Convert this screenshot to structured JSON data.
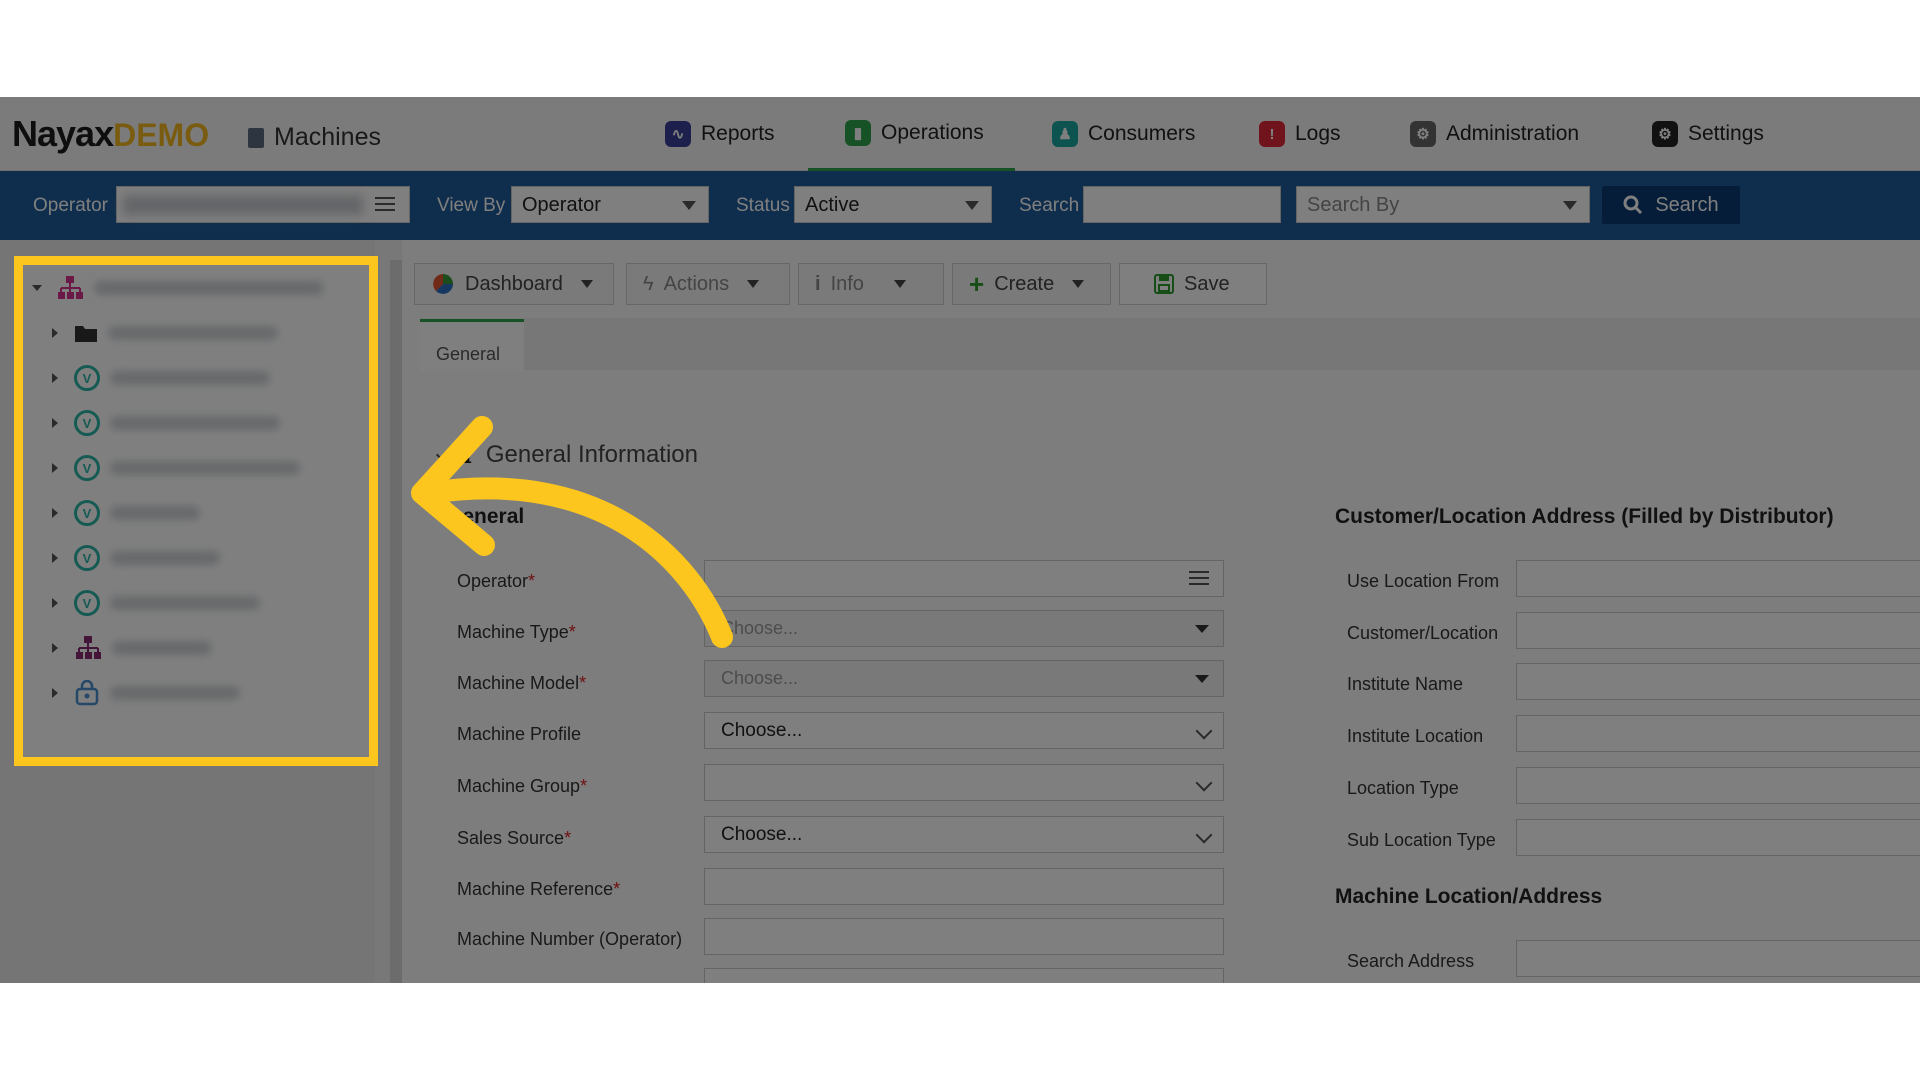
{
  "header": {
    "logo_brand": "Nayax",
    "logo_suffix": "DEMO",
    "module": "Machines",
    "nav": [
      {
        "label": "Reports",
        "color": "#3b3f9a"
      },
      {
        "label": "Operations",
        "color": "#2ea44f",
        "active": true
      },
      {
        "label": "Consumers",
        "color": "#1aa6a0"
      },
      {
        "label": "Logs",
        "color": "#e0263a"
      },
      {
        "label": "Administration",
        "color": "#555555"
      },
      {
        "label": "Settings",
        "color": "#222222"
      }
    ]
  },
  "toolbar": {
    "operator_label": "Operator",
    "viewby_label": "View By",
    "viewby_value": "Operator",
    "status_label": "Status",
    "status_value": "Active",
    "search_label": "Search",
    "searchby_placeholder": "Search By",
    "search_button": "Search"
  },
  "actions": {
    "dashboard": "Dashboard",
    "actions": "Actions",
    "info": "Info",
    "create": "Create",
    "save": "Save"
  },
  "tab": {
    "label": "General"
  },
  "section": {
    "title": "General Information"
  },
  "general": {
    "heading": "General",
    "fields": [
      {
        "label": "Operator",
        "required": true,
        "value": "",
        "kind": "list"
      },
      {
        "label": "Machine Type",
        "required": true,
        "value": "Choose...",
        "kind": "select-disabled"
      },
      {
        "label": "Machine Model",
        "required": true,
        "value": "Choose...",
        "kind": "select-disabled"
      },
      {
        "label": "Machine Profile",
        "required": false,
        "value": "Choose...",
        "kind": "select"
      },
      {
        "label": "Machine Group",
        "required": true,
        "value": "",
        "kind": "select"
      },
      {
        "label": "Sales Source",
        "required": true,
        "value": "Choose...",
        "kind": "select"
      },
      {
        "label": "Machine Reference",
        "required": true,
        "value": "",
        "kind": "text"
      },
      {
        "label": "Machine Number (Operator)",
        "required": false,
        "value": "",
        "kind": "text"
      }
    ],
    "required_mark": "*"
  },
  "address": {
    "heading": "Customer/Location Address (Filled by Distributor)",
    "fields": [
      "Use Location From",
      "Customer/Location",
      "Institute Name",
      "Institute Location",
      "Location Type",
      "Sub Location Type"
    ],
    "machine_location_heading": "Machine Location/Address",
    "search_address_label": "Search Address"
  },
  "annotation": {
    "highlight_color": "#fcc61e",
    "arrow_color": "#fcc61e"
  }
}
